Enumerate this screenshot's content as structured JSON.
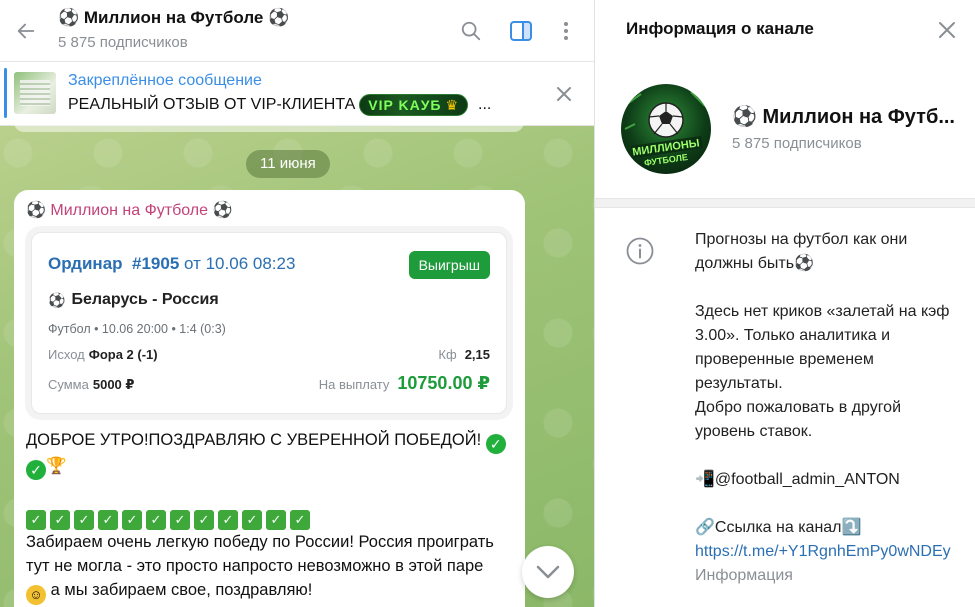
{
  "header": {
    "title": "⚽ Миллион на Футболе ⚽",
    "subscribers": "5 875 подписчиков"
  },
  "pinned": {
    "label": "Закреплённое сообщение",
    "text": "РЕАЛЬНЫЙ ОТЗЫВ ОТ VIP-КЛИЕНТА",
    "badge": "VIP KAУБ",
    "ellipsis": "..."
  },
  "chat": {
    "date_chip": "11 июня",
    "post": {
      "author": "⚽ Миллион на Футболе ⚽",
      "card": {
        "bet_type": "Ординар",
        "bet_number": "#1905",
        "bet_date": "от 10.06 08:23",
        "status": "Выигрыш",
        "match": "Беларусь - Россия",
        "meta": "Футбол • 10.06 20:00 • 1:4 (0:3)",
        "outcome_label": "Исход",
        "outcome_value": "Фора 2 (-1)",
        "coef_label": "Кф",
        "coef_value": "2,15",
        "sum_label": "Сумма",
        "sum_value": "5000 ₽",
        "payout_label": "На выплату",
        "payout_value": "10750.00 ₽"
      },
      "headline": "ДОБРОЕ УТРО!ПОЗДРАВЛЯЮ С УВЕРЕННОЙ ПОБЕДОЙ!",
      "body": "Забираем очень легкую победу по России! Россия проиграть тут не могла - это просто напросто невозможно в этой паре",
      "body_tail": "а мы забираем свое, поздравляю!",
      "checkmarks_count": 12
    }
  },
  "info_panel": {
    "title": "Информация о канале",
    "channel_name": "⚽ Миллион на Футб...",
    "subscribers": "5 875 подписчиков",
    "description": [
      "Прогнозы на футбол как они должны быть⚽",
      "",
      "Здесь нет криков «залетай на кэф 3.00». Только аналитика и проверенные временем результаты.",
      "Добро пожаловать в другой уровень ставок.",
      "",
      "📲@football_admin_ANTON",
      "",
      "🔗Ссылка на канал⤵️"
    ],
    "link": "https://t.me/+Y1RgnhEmPy0wNDEy",
    "footer_label": "Информация"
  },
  "colors": {
    "accent": "#3a8ee6",
    "author": "#c2437a",
    "win": "#1e9b3a",
    "chat_bg": "#a9c77e"
  }
}
